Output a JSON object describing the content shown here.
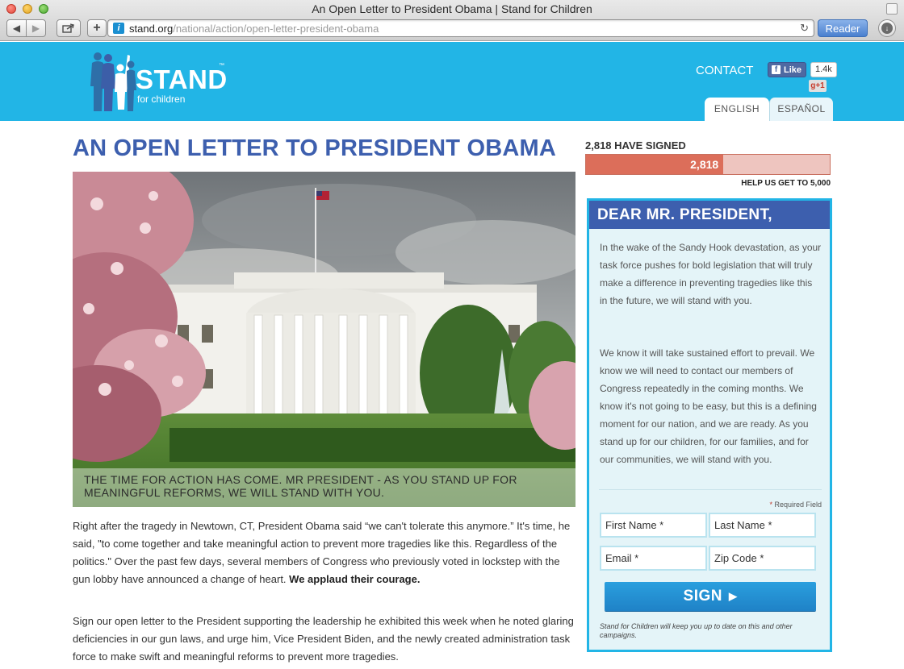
{
  "browser": {
    "window_title": "An Open Letter to President Obama | Stand for Children",
    "url_host": "stand.org",
    "url_path": "/national/action/open-letter-president-obama",
    "reader_label": "Reader"
  },
  "header": {
    "logo_text": "STAND",
    "logo_tm": "™",
    "logo_subtitle": "for children",
    "contact_label": "CONTACT",
    "fb_like_label": "Like",
    "fb_like_count": "1.4k",
    "gplus_label": "g+1",
    "lang_tabs": [
      "ENGLISH",
      "ESPAÑOL"
    ],
    "active_lang": "ENGLISH"
  },
  "main": {
    "title": "AN OPEN LETTER TO PRESIDENT OBAMA",
    "hero_caption": "THE TIME FOR ACTION HAS COME. MR PRESIDENT - AS YOU STAND UP FOR MEANINGFUL REFORMS, WE WILL STAND WITH YOU.",
    "paragraph1": "Right after the tragedy in Newtown, CT, President Obama said “we can't tolerate this anymore.” It's time, he said, \"to come together and take meaningful action to prevent more tragedies like this. Regardless of the politics.\"  Over the past few days, several members of Congress who previously voted in lockstep with the gun lobby have announced a change of heart.",
    "paragraph1_bold": "We applaud their courage.",
    "paragraph2": "Sign our open letter to the President supporting the leadership he exhibited this week when he noted glaring deficiencies in our gun laws, and urge him, Vice President Biden, and the newly created administration task force to make swift and meaningful reforms to prevent more tragedies."
  },
  "petition": {
    "signed_label": "2,818 HAVE SIGNED",
    "signed_count": "2,818",
    "signed_value": 2818,
    "goal_value": 5000,
    "goal_label": "HELP US GET TO 5,000",
    "letter_heading": "DEAR MR. PRESIDENT,",
    "letter_p1": "In the wake of the Sandy Hook devastation, as your task force pushes for bold legislation that will truly make a difference in preventing tragedies like this in the future, we will stand with you.",
    "letter_p2": "We know it will take sustained effort to prevail. We know we will need to contact our members of Congress repeatedly in the coming months. We know it's not going to be easy, but this is a defining moment for our nation, and we are ready. As you stand up for our children, for our families, and for our communities, we will stand with you.",
    "required_star": "*",
    "required_label": " Required Field",
    "fields": {
      "first_name": "First Name *",
      "last_name": "Last Name *",
      "email": "Email *",
      "zip": "Zip Code *"
    },
    "sign_label": "SIGN",
    "disclaimer": "Stand for Children will keep you up to date on this and other campaigns."
  },
  "colors": {
    "header_blue": "#22b5e6",
    "title_blue": "#3d5fae",
    "progress_fill": "#dc6e5a",
    "progress_bg": "#eec5bf",
    "sign_button": "#1f82c7"
  },
  "icons": [
    "back-arrow-icon",
    "forward-arrow-icon",
    "share-icon",
    "add-tab-icon",
    "site-favicon-icon",
    "reload-icon",
    "downloads-icon",
    "facebook-icon",
    "google-plus-icon",
    "chevron-right-icon"
  ]
}
